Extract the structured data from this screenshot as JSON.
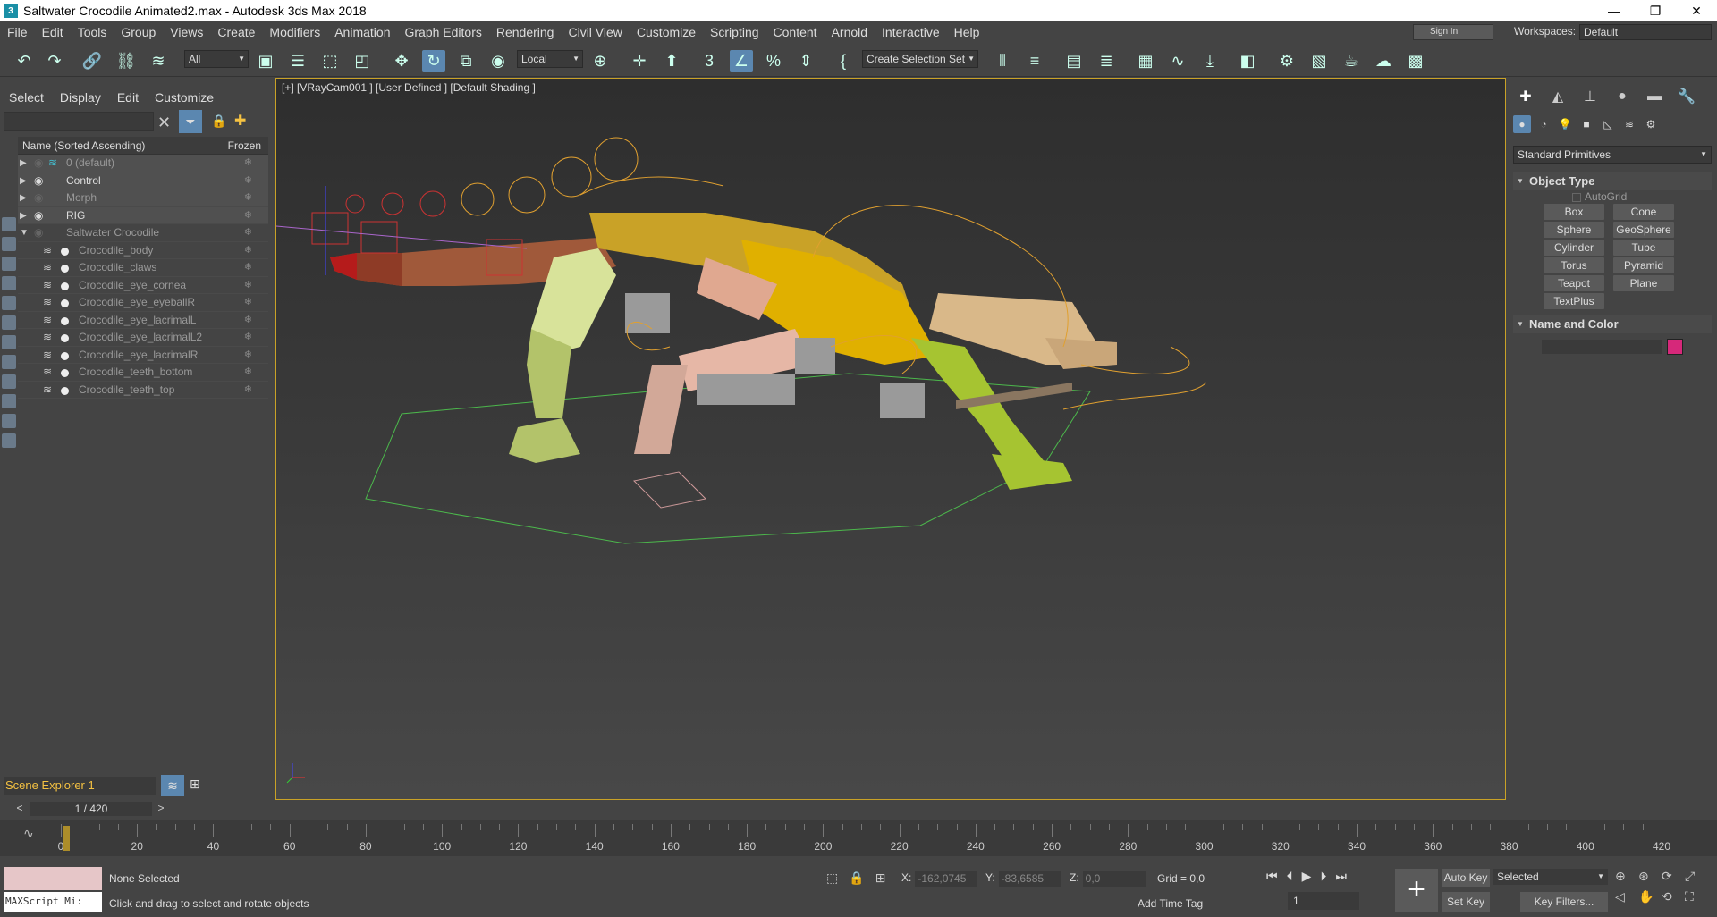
{
  "window": {
    "title": "Saltwater Crocodile Animated2.max - Autodesk 3ds Max 2018",
    "app_icon_text": "3",
    "minimize": "—",
    "maximize": "❐",
    "close": "✕"
  },
  "menu": {
    "items": [
      "File",
      "Edit",
      "Tools",
      "Group",
      "Views",
      "Create",
      "Modifiers",
      "Animation",
      "Graph Editors",
      "Rendering",
      "Civil View",
      "Customize",
      "Scripting",
      "Content",
      "Arnold",
      "Interactive",
      "Help"
    ],
    "sign_in": "Sign In",
    "workspaces_label": "Workspaces:",
    "workspaces_value": "Default"
  },
  "toolbar": {
    "selection_filter": "All",
    "ref_coord": "Local",
    "named_selection": "Create Selection Set"
  },
  "scene_explorer": {
    "tabs": [
      "Select",
      "Display",
      "Edit",
      "Customize"
    ],
    "column_name": "Name (Sorted Ascending)",
    "column_frozen": "Frozen",
    "rows": [
      {
        "label": "0 (default)",
        "type": "layer",
        "dim": true
      },
      {
        "label": "Control",
        "type": "layer",
        "dim": false
      },
      {
        "label": "Morph",
        "type": "layer",
        "dim": true
      },
      {
        "label": "RIG",
        "type": "layer",
        "dim": false
      },
      {
        "label": "Saltwater Crocodile",
        "type": "layer-open",
        "dim": true
      },
      {
        "label": "Crocodile_body",
        "type": "child"
      },
      {
        "label": "Crocodile_claws",
        "type": "child"
      },
      {
        "label": "Crocodile_eye_cornea",
        "type": "child"
      },
      {
        "label": "Crocodile_eye_eyeballR",
        "type": "child"
      },
      {
        "label": "Crocodile_eye_lacrimalL",
        "type": "child"
      },
      {
        "label": "Crocodile_eye_lacrimalL2",
        "type": "child"
      },
      {
        "label": "Crocodile_eye_lacrimalR",
        "type": "child"
      },
      {
        "label": "Crocodile_teeth_bottom",
        "type": "child"
      },
      {
        "label": "Crocodile_teeth_top",
        "type": "child"
      }
    ],
    "footer_name": "Scene Explorer 1"
  },
  "viewport": {
    "label": "[+] [VRayCam001 ] [User Defined ] [Default Shading ]"
  },
  "command_panel": {
    "category": "Standard Primitives",
    "object_type_title": "Object Type",
    "autogrid": "AutoGrid",
    "primitives": [
      "Box",
      "Cone",
      "Sphere",
      "GeoSphere",
      "Cylinder",
      "Tube",
      "Torus",
      "Pyramid",
      "Teapot",
      "Plane",
      "TextPlus"
    ],
    "name_color_title": "Name and Color",
    "object_color": "#d6287a"
  },
  "timeline": {
    "frame_display": "1 / 420",
    "ticks": [
      0,
      20,
      40,
      60,
      80,
      100,
      120,
      140,
      160,
      180,
      200,
      220,
      240,
      260,
      280,
      300,
      320,
      340,
      360,
      380,
      400,
      420
    ],
    "start": 0,
    "end": 420,
    "current": 1
  },
  "status": {
    "maxscript_label": "MAXScript Mi:",
    "selection": "None Selected",
    "prompt": "Click and drag to select and rotate objects",
    "x_label": "X:",
    "x_value": "-162,0745",
    "y_label": "Y:",
    "y_value": "-83,6585",
    "z_label": "Z:",
    "z_value": "0,0",
    "grid": "Grid = 0,0",
    "add_time_tag": "Add Time Tag",
    "current_frame": "1",
    "auto_key": "Auto Key",
    "set_key": "Set Key",
    "key_mode": "Selected",
    "key_filters": "Key Filters..."
  }
}
